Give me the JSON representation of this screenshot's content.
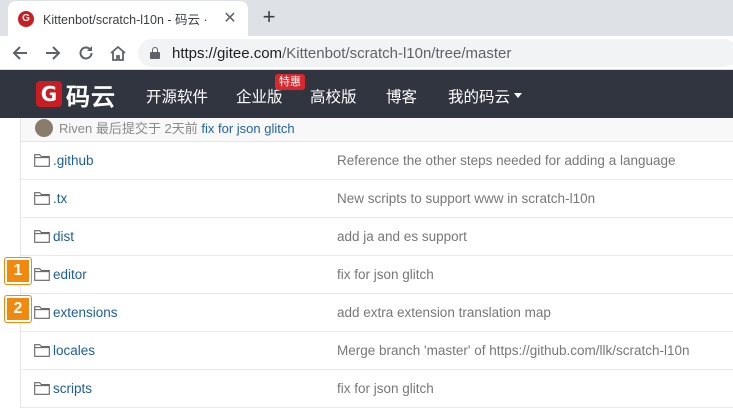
{
  "browser": {
    "tab_title": "Kittenbot/scratch-l10n - 码云 ·",
    "tab_close": "✕",
    "new_tab": "+",
    "url_host": "https://gitee.com",
    "url_path": "/Kittenbot/scratch-l10n/tree/master"
  },
  "header": {
    "logo_mark": "G",
    "logo_text": "码云",
    "nav": [
      "开源软件",
      "企业版",
      "高校版",
      "博客",
      "我的码云"
    ],
    "badge": "特惠"
  },
  "commit": {
    "author": "Riven",
    "text": "最后提交于",
    "when": "2天前",
    "message": "fix for json glitch"
  },
  "files": [
    {
      "name": ".github",
      "message": "Reference the other steps needed for adding a language"
    },
    {
      "name": ".tx",
      "message": "New scripts to support www in scratch-l10n"
    },
    {
      "name": "dist",
      "message": "add ja and es support"
    },
    {
      "name": "editor",
      "message": "fix for json glitch"
    },
    {
      "name": "extensions",
      "message": "add extra extension translation map"
    },
    {
      "name": "locales",
      "message": "Merge branch 'master' of https://github.com/llk/scratch-l10n"
    },
    {
      "name": "scripts",
      "message": "fix for json glitch"
    }
  ],
  "markers": [
    "1",
    "2"
  ],
  "colors": {
    "brand": "#c71d23",
    "header_bg": "#30353f",
    "marker": "#f2890f",
    "link": "#1d5d98"
  }
}
